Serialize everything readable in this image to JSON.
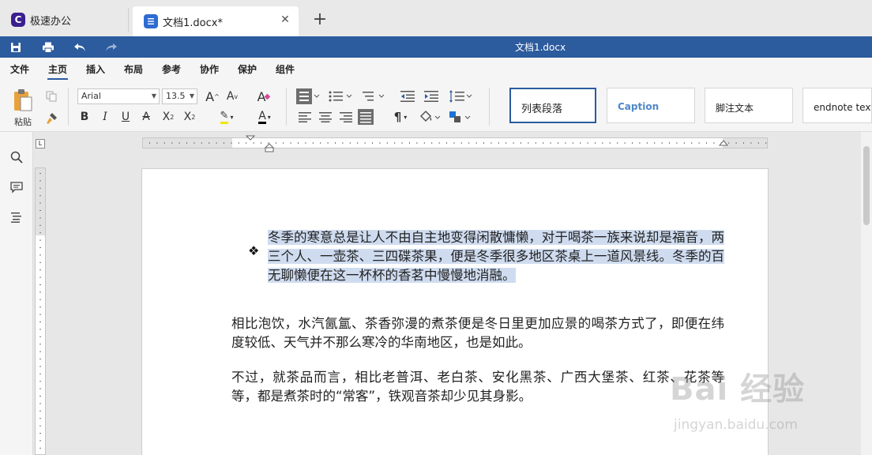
{
  "tabs": {
    "app_title": "极速办公",
    "doc_title": "文档1.docx*"
  },
  "titlebar": {
    "title": "文档1.docx"
  },
  "menu": {
    "items": [
      "文件",
      "主页",
      "插入",
      "布局",
      "参考",
      "协作",
      "保护",
      "组件"
    ],
    "active": "主页"
  },
  "ribbon": {
    "paste_label": "粘贴",
    "font_name": "Arial",
    "font_size": "13.5",
    "styles": [
      "列表段落",
      "Caption",
      "脚注文本",
      "endnote text"
    ]
  },
  "document": {
    "paragraphs": [
      "冬季的寒意总是让人不由自主地变得闲散慵懒，对于喝茶一族来说却是福音，两三个人、一壶茶、三四碟茶果，便是冬季很多地区茶桌上一道风景线。冬季的百无聊懒便在这一杯杯的香茗中慢慢地消融。",
      "相比泡饮，水汽氤氲、茶香弥漫的煮茶便是冬日里更加应景的喝茶方式了，即便在纬度较低、天气并不那么寒冷的华南地区，也是如此。",
      "不过，就茶品而言，相比老普洱、老白茶、安化黑茶、广西大堡茶、红茶、花茶等等，都是煮茶时的“常客”，铁观音茶却少见其身影。"
    ]
  },
  "watermark": {
    "main": "Bai 经验",
    "sub": "jingyan.baidu.com"
  },
  "colors": {
    "accent": "#2c5b9e",
    "selection": "#cfdcf0"
  }
}
